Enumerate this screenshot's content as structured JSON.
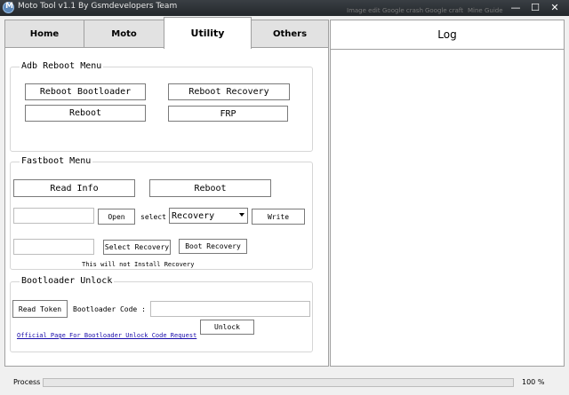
{
  "window": {
    "title": "Moto Tool v1.1 By Gsmdevelopers Team",
    "minimize": "—",
    "maximize": "☐",
    "close": "✕"
  },
  "background_items": [
    "Image edit",
    "Google crash",
    "Google craft",
    "Mine Guide"
  ],
  "tabs": [
    {
      "label": "Home",
      "active": false
    },
    {
      "label": "Moto",
      "active": false
    },
    {
      "label": "Utility",
      "active": true
    },
    {
      "label": "Others",
      "active": false
    }
  ],
  "log": {
    "title": "Log"
  },
  "adb": {
    "title": "Adb Reboot Menu",
    "reboot_bootloader": "Reboot Bootloader",
    "reboot_recovery": "Reboot Recovery",
    "reboot": "Reboot",
    "frp": "FRP"
  },
  "fastboot": {
    "title": "Fastboot Menu",
    "read_info": "Read Info",
    "reboot": "Reboot",
    "file_path": "",
    "open": "Open",
    "select_label": "select",
    "partition_options": [
      "Recovery"
    ],
    "partition_selected": "Recovery",
    "write": "Write",
    "recovery_path": "",
    "select_recovery": "Select Recovery",
    "boot_recovery": "Boot Recovery",
    "note": "This will not Install Recovery"
  },
  "bootloader": {
    "title": "Bootloader Unlock",
    "read_token": "Read Token",
    "code_label": "Bootloader Code :",
    "code_value": "",
    "unlock": "Unlock",
    "link": "Official Page For Bootloader Unlock Code Request"
  },
  "status": {
    "label": "Process",
    "progress": 0,
    "progress_text": "100 %"
  },
  "colors": {
    "link": "#1a0dab",
    "titlebar": "#2b2f33"
  }
}
